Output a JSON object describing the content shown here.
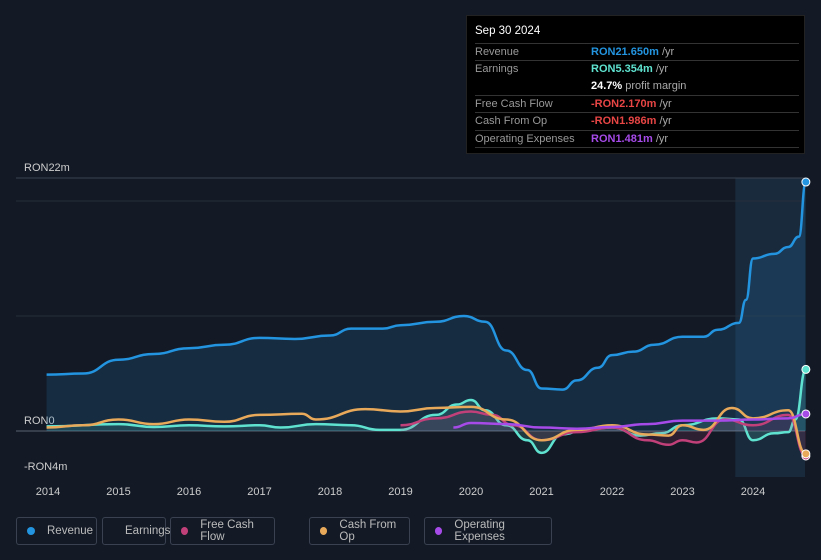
{
  "tooltip": {
    "date": "Sep 30 2024",
    "rows": [
      {
        "label": "Revenue",
        "value": "RON21.650m",
        "unit": "/yr",
        "color": "#2394df"
      },
      {
        "label": "Earnings",
        "value": "RON5.354m",
        "unit": "/yr",
        "color": "#5fe3d0"
      },
      {
        "label": "",
        "value": "24.7%",
        "unit": "profit margin",
        "color": "#ffffff"
      },
      {
        "label": "Free Cash Flow",
        "value": "-RON2.170m",
        "unit": "/yr",
        "color": "#e84545"
      },
      {
        "label": "Cash From Op",
        "value": "-RON1.986m",
        "unit": "/yr",
        "color": "#e84545"
      },
      {
        "label": "Operating Expenses",
        "value": "RON1.481m",
        "unit": "/yr",
        "color": "#a64ae8"
      }
    ]
  },
  "chart_data": {
    "type": "line",
    "ylim": [
      -4,
      22
    ],
    "y_tick_labels": [
      "RON22m",
      "RON0",
      "-RON4m"
    ],
    "x_tick_labels": [
      "2014",
      "2015",
      "2016",
      "2017",
      "2018",
      "2019",
      "2020",
      "2021",
      "2022",
      "2023",
      "2024"
    ],
    "forecast_shade_start": 2023.75,
    "series": [
      {
        "name": "Revenue",
        "color": "#2394df",
        "fill": true,
        "points": [
          [
            2013.98,
            4.9
          ],
          [
            2014.5,
            5.0
          ],
          [
            2015,
            6.2
          ],
          [
            2015.5,
            6.7
          ],
          [
            2016,
            7.2
          ],
          [
            2016.5,
            7.5
          ],
          [
            2017,
            8.1
          ],
          [
            2017.5,
            8.0
          ],
          [
            2018,
            8.3
          ],
          [
            2018.3,
            8.9
          ],
          [
            2018.75,
            8.9
          ],
          [
            2019,
            9.2
          ],
          [
            2019.5,
            9.5
          ],
          [
            2019.9,
            10.0
          ],
          [
            2020.2,
            9.5
          ],
          [
            2020.5,
            7.0
          ],
          [
            2020.8,
            5.3
          ],
          [
            2021,
            3.7
          ],
          [
            2021.3,
            3.6
          ],
          [
            2021.5,
            4.4
          ],
          [
            2021.8,
            5.5
          ],
          [
            2022,
            6.6
          ],
          [
            2022.3,
            6.9
          ],
          [
            2022.6,
            7.5
          ],
          [
            2023,
            8.2
          ],
          [
            2023.3,
            8.2
          ],
          [
            2023.5,
            8.8
          ],
          [
            2023.8,
            9.4
          ],
          [
            2023.9,
            11.4
          ],
          [
            2024,
            15.0
          ],
          [
            2024.3,
            15.4
          ],
          [
            2024.5,
            16.0
          ],
          [
            2024.65,
            16.9
          ],
          [
            2024.75,
            21.65
          ]
        ]
      },
      {
        "name": "Earnings",
        "color": "#5fe3d0",
        "fill": true,
        "points": [
          [
            2013.98,
            0.4
          ],
          [
            2015,
            0.6
          ],
          [
            2015.5,
            0.35
          ],
          [
            2016,
            0.5
          ],
          [
            2016.5,
            0.4
          ],
          [
            2017,
            0.5
          ],
          [
            2017.3,
            0.3
          ],
          [
            2017.8,
            0.6
          ],
          [
            2018.3,
            0.5
          ],
          [
            2018.7,
            0.1
          ],
          [
            2019,
            0.1
          ],
          [
            2019.5,
            1.4
          ],
          [
            2019.8,
            2.3
          ],
          [
            2020,
            2.7
          ],
          [
            2020.2,
            1.8
          ],
          [
            2020.5,
            0.5
          ],
          [
            2020.8,
            -0.8
          ],
          [
            2021,
            -1.9
          ],
          [
            2021.3,
            -0.3
          ],
          [
            2021.6,
            0.1
          ],
          [
            2022,
            0.3
          ],
          [
            2022.4,
            -0.4
          ],
          [
            2022.7,
            -0.2
          ],
          [
            2023,
            0.5
          ],
          [
            2023.5,
            1.1
          ],
          [
            2023.8,
            1.0
          ],
          [
            2024,
            -0.8
          ],
          [
            2024.3,
            -0.2
          ],
          [
            2024.5,
            -0.1
          ],
          [
            2024.6,
            1.0
          ],
          [
            2024.75,
            5.354
          ]
        ]
      },
      {
        "name": "Free Cash Flow",
        "color": "#c2407a",
        "fill": true,
        "points": [
          [
            2019,
            0.5
          ],
          [
            2019.5,
            1.1
          ],
          [
            2020,
            1.7
          ],
          [
            2020.3,
            1.4
          ],
          [
            2020.6,
            0.5
          ],
          [
            2021,
            -0.8
          ],
          [
            2021.5,
            -0.1
          ],
          [
            2022,
            0.3
          ],
          [
            2022.5,
            -0.8
          ],
          [
            2022.8,
            -1.2
          ],
          [
            2023,
            -0.8
          ],
          [
            2023.2,
            -1.0
          ],
          [
            2023.6,
            1.0
          ],
          [
            2024,
            0.5
          ],
          [
            2024.5,
            1.4
          ],
          [
            2024.75,
            -2.17
          ]
        ]
      },
      {
        "name": "Cash From Op",
        "color": "#e8a95a",
        "fill": false,
        "points": [
          [
            2013.98,
            0.3
          ],
          [
            2014.5,
            0.5
          ],
          [
            2015,
            1.0
          ],
          [
            2015.5,
            0.6
          ],
          [
            2016,
            1.0
          ],
          [
            2016.5,
            0.8
          ],
          [
            2017,
            1.4
          ],
          [
            2017.6,
            1.5
          ],
          [
            2017.8,
            1.0
          ],
          [
            2018.5,
            1.9
          ],
          [
            2019,
            1.7
          ],
          [
            2019.5,
            2.0
          ],
          [
            2020,
            2.1
          ],
          [
            2020.5,
            1.0
          ],
          [
            2021,
            -0.8
          ],
          [
            2021.5,
            0.1
          ],
          [
            2022,
            0.5
          ],
          [
            2022.5,
            -0.3
          ],
          [
            2022.8,
            -0.4
          ],
          [
            2023,
            0.5
          ],
          [
            2023.3,
            0.1
          ],
          [
            2023.7,
            2.0
          ],
          [
            2024,
            1.1
          ],
          [
            2024.5,
            1.8
          ],
          [
            2024.75,
            -1.986
          ]
        ]
      },
      {
        "name": "Operating Expenses",
        "color": "#a64ae8",
        "fill": false,
        "points": [
          [
            2019.75,
            0.3
          ],
          [
            2020,
            0.7
          ],
          [
            2020.5,
            0.6
          ],
          [
            2021,
            0.3
          ],
          [
            2021.5,
            0.2
          ],
          [
            2022,
            0.35
          ],
          [
            2022.5,
            0.6
          ],
          [
            2023,
            0.9
          ],
          [
            2023.5,
            0.9
          ],
          [
            2024,
            1.0
          ],
          [
            2024.5,
            1.1
          ],
          [
            2024.75,
            1.481
          ]
        ]
      }
    ]
  }
}
